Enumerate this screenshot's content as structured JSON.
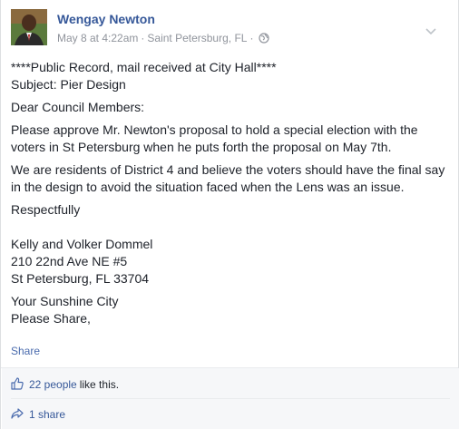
{
  "post": {
    "author": "Wengay Newton",
    "timestamp": "May 8 at 4:22am",
    "location": "Saint Petersburg, FL",
    "separator": "·",
    "paragraphs": [
      [
        "****Public Record, mail received at City Hall****",
        "Subject: Pier Design"
      ],
      [
        "Dear Council Members:"
      ],
      [
        "Please approve Mr. Newton's proposal to hold a special election with the",
        "voters in St Petersburg when he puts forth the proposal on May 7th."
      ],
      [
        "We are residents of District 4 and believe the voters should have the final say",
        "in the design to avoid the situation faced when the Lens was an issue."
      ],
      [
        "Respectfully"
      ],
      [
        ""
      ],
      [
        "Kelly and Volker Dommel",
        "210 22nd Ave NE #5",
        "St Petersburg, FL 33704"
      ],
      [
        "Your Sunshine City",
        "Please Share,"
      ]
    ],
    "share_label": "Share"
  },
  "footer": {
    "likes_count": "22 people",
    "likes_suffix": "like this.",
    "shares": "1 share"
  },
  "colors": {
    "link": "#365899",
    "meta": "#90949c",
    "footer_bg": "#f6f7f9"
  },
  "icons": {
    "globe": "globe-icon",
    "chevron": "chevron-down-icon",
    "like": "thumbs-up-icon",
    "share": "share-arrow-icon"
  }
}
